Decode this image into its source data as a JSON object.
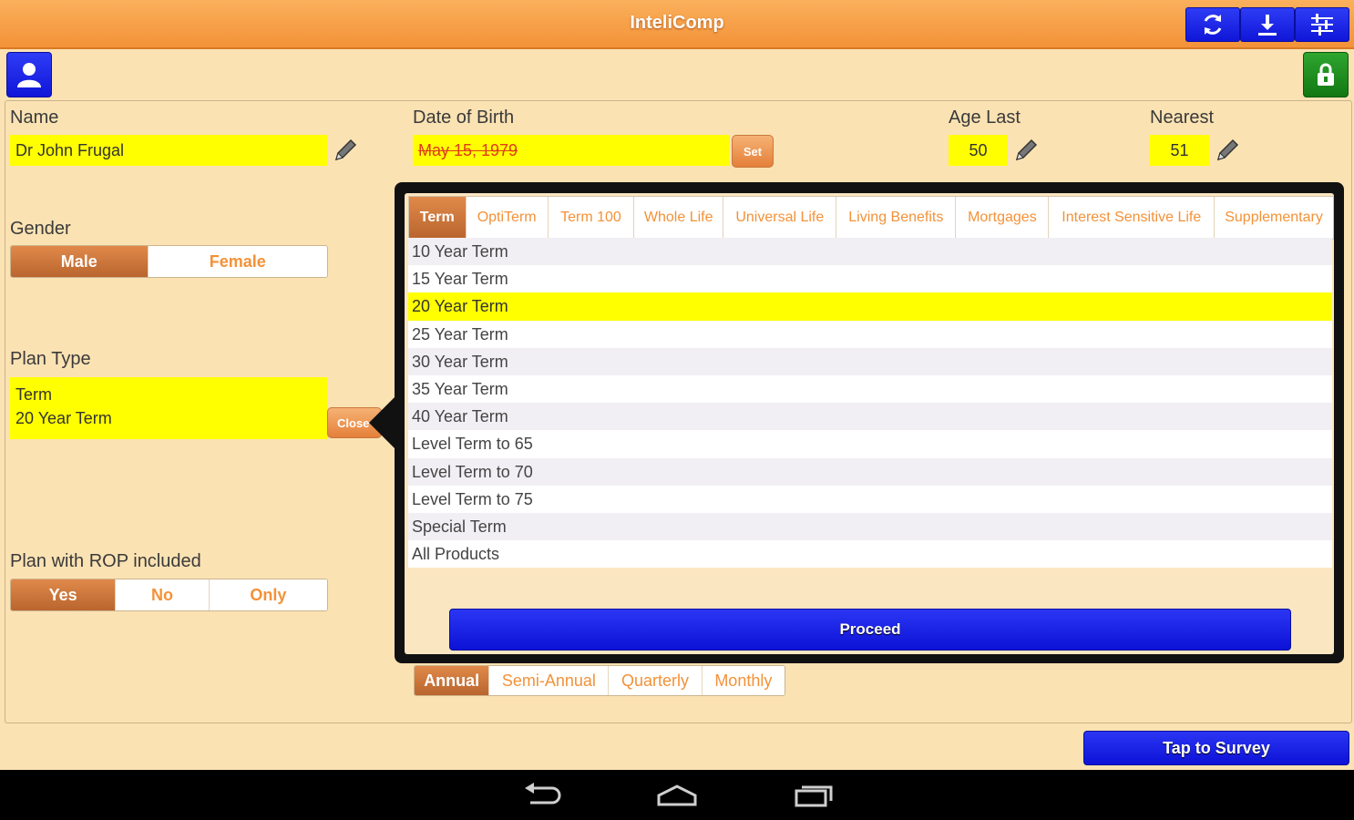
{
  "app": {
    "title": "InteliComp"
  },
  "toolbar": {
    "icons": [
      "refresh-icon",
      "download-icon",
      "settings-sliders-icon"
    ]
  },
  "form": {
    "name": {
      "label": "Name",
      "value": "Dr John Frugal"
    },
    "dob": {
      "label": "Date of Birth",
      "value": "May 15, 1979",
      "set_label": "Set"
    },
    "age_last": {
      "label": "Age Last",
      "value": "50"
    },
    "age_nearest": {
      "label": "Nearest",
      "value": "51"
    },
    "gender": {
      "label": "Gender",
      "options": [
        "Male",
        "Female"
      ],
      "selected": "Male"
    },
    "plan_type": {
      "label": "Plan Type",
      "line1": "Term",
      "line2": "20 Year Term",
      "close_label": "Close"
    },
    "rop": {
      "label": "Plan with ROP included",
      "options": [
        "Yes",
        "No",
        "Only"
      ],
      "selected": "Yes"
    },
    "frequency": {
      "options": [
        "Annual",
        "Semi-Annual",
        "Quarterly",
        "Monthly"
      ],
      "selected": "Annual"
    }
  },
  "popup": {
    "tabs": [
      "Term",
      "OptiTerm",
      "Term 100",
      "Whole Life",
      "Universal Life",
      "Living Benefits",
      "Mortgages",
      "Interest Sensitive Life",
      "Supplementary"
    ],
    "selected_tab": "Term",
    "plans": [
      "10 Year Term",
      "15 Year Term",
      "20 Year Term",
      "25 Year Term",
      "30 Year Term",
      "35 Year Term",
      "40 Year Term",
      "Level Term to 65",
      "Level Term to 70",
      "Level Term to 75",
      "Special Term",
      "All Products"
    ],
    "selected_plan": "20 Year Term",
    "proceed_label": "Proceed"
  },
  "survey": {
    "label": "Tap to Survey"
  },
  "colors": {
    "accent_orange": "#f39238",
    "button_blue": "#1016d8",
    "highlight_yellow": "#ffff00",
    "background": "#fbe2b3"
  }
}
